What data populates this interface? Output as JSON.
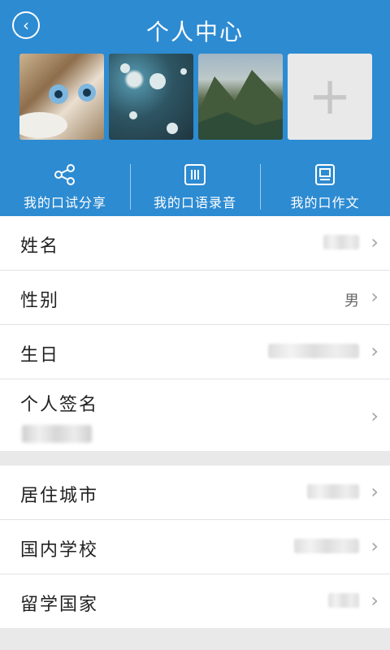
{
  "header": {
    "title": "个人中心",
    "photos": [
      {
        "name": "cat-photo"
      },
      {
        "name": "waterdrop-photo"
      },
      {
        "name": "mountain-photo"
      }
    ],
    "add_photo_symbol": "+",
    "actions": [
      {
        "label": "我的口试分享",
        "icon": "share-icon"
      },
      {
        "label": "我的口语录音",
        "icon": "recording-icon"
      },
      {
        "label": "我的口作文",
        "icon": "essay-icon"
      }
    ]
  },
  "profile": {
    "rows": [
      {
        "label": "姓名"
      },
      {
        "label": "性别",
        "value": "男"
      },
      {
        "label": "生日"
      },
      {
        "label": "个人签名"
      }
    ]
  },
  "extra": {
    "rows": [
      {
        "label": "居住城市"
      },
      {
        "label": "国内学校"
      },
      {
        "label": "留学国家"
      }
    ]
  },
  "colors": {
    "header_blue": "#2d8bd2"
  }
}
